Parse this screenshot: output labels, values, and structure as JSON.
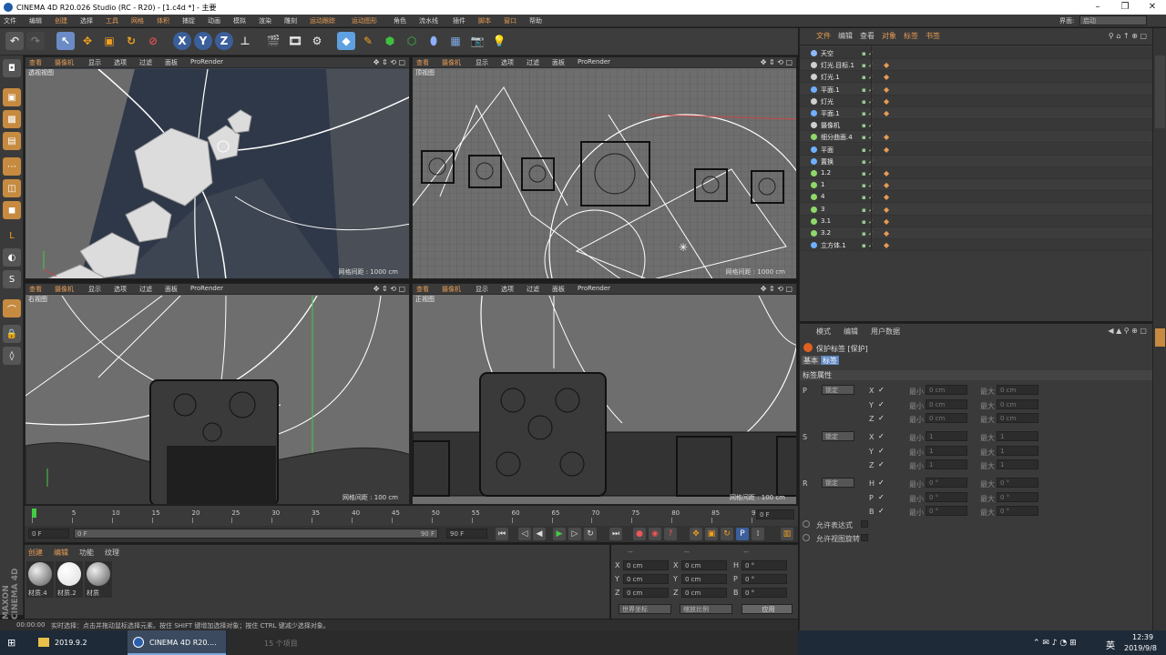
{
  "window": {
    "title": "CINEMA 4D R20.026 Studio (RC - R20) - [1.c4d *] - 主要"
  },
  "menu": [
    "文件",
    "编辑",
    "创建",
    "选择",
    "工具",
    "网格",
    "体积",
    "捕捉",
    "动画",
    "模拟",
    "渲染",
    "雕刻",
    "运动跟踪",
    "运动图形",
    "角色",
    "流水线",
    "插件",
    "脚本",
    "窗口",
    "帮助"
  ],
  "menu_highlight": [
    "创建",
    "工具",
    "网格",
    "体积",
    "运动跟踪",
    "运动图形",
    "脚本",
    "窗口"
  ],
  "interface": {
    "label": "界面:",
    "value": "启动"
  },
  "viewport_menu": [
    "查看",
    "摄像机",
    "显示",
    "选项",
    "过滤",
    "面板",
    "ProRender"
  ],
  "viewports": [
    {
      "label": "透视视图",
      "grid": ""
    },
    {
      "label": "顶视图",
      "grid": "网格间距 : 1000 cm"
    },
    {
      "label": "右视图",
      "grid": "网格间距 : 100 cm"
    },
    {
      "label": "正视图",
      "grid": "网格间距 : 100 cm"
    }
  ],
  "viewport1_grid": "网格间距 : 1000 cm",
  "timeline": {
    "ticks": [
      "0",
      "5",
      "10",
      "15",
      "20",
      "25",
      "30",
      "35",
      "40",
      "45",
      "50",
      "55",
      "60",
      "65",
      "70",
      "75",
      "80",
      "85",
      "90"
    ],
    "current": "0 F",
    "start": "0 F",
    "range_start": "0 F",
    "range_end": "90 F",
    "end": "90 F",
    "end2": "90 F"
  },
  "material_menu": [
    "创建",
    "编辑",
    "功能",
    "纹理"
  ],
  "materials": [
    "材质.4",
    "材质.2",
    "材质"
  ],
  "coords": {
    "headers": [
      "--",
      "--",
      "--"
    ],
    "rows": [
      [
        "X",
        "0 cm",
        "X",
        "0 cm",
        "H",
        "0 °"
      ],
      [
        "Y",
        "0 cm",
        "Y",
        "0 cm",
        "P",
        "0 °"
      ],
      [
        "Z",
        "0 cm",
        "Z",
        "0 cm",
        "B",
        "0 °"
      ]
    ],
    "mode1": "世界坐标",
    "mode2": "缩放比例",
    "apply": "应用"
  },
  "status": {
    "time": "00:00:00",
    "text": "实时选择：点击并拖动鼠标选择元素。按住 SHIFT 键增加选择对象；按住 CTRL 键减少选择对象。"
  },
  "objects_menu": [
    "文件",
    "编辑",
    "查看",
    "对象",
    "标签",
    "书签"
  ],
  "objects": [
    {
      "name": "天空",
      "color": "#8fb8ff"
    },
    {
      "name": "灯光.目标.1",
      "color": "#cfcfcf"
    },
    {
      "name": "灯光.1",
      "color": "#cfcfcf"
    },
    {
      "name": "平面.1",
      "color": "#6fb0ff"
    },
    {
      "name": "灯光",
      "color": "#cfcfcf"
    },
    {
      "name": "平面.1",
      "color": "#6fb0ff"
    },
    {
      "name": "摄像机",
      "color": "#cfcfcf"
    },
    {
      "name": "细分曲面.4",
      "color": "#8fd86a"
    },
    {
      "name": "平面",
      "color": "#6fb0ff"
    },
    {
      "name": "置换",
      "color": "#6fb0ff"
    },
    {
      "name": "1.2",
      "color": "#8fd86a"
    },
    {
      "name": "1",
      "color": "#8fd86a"
    },
    {
      "name": "4",
      "color": "#8fd86a"
    },
    {
      "name": "3",
      "color": "#8fd86a"
    },
    {
      "name": "3.1",
      "color": "#8fd86a"
    },
    {
      "name": "3.2",
      "color": "#8fd86a"
    },
    {
      "name": "立方体.1",
      "color": "#6fb0ff"
    }
  ],
  "attr": {
    "menu": [
      "模式",
      "编辑",
      "用户数据"
    ],
    "title": "保护标签 [保护]",
    "tabs": [
      "基本",
      "标签"
    ],
    "section": "标签属性",
    "groups": [
      {
        "k": "P",
        "v": "锁定",
        "axes": [
          "X",
          "Y",
          "Z"
        ],
        "val": "0 cm"
      },
      {
        "k": "S",
        "v": "锁定",
        "axes": [
          "X",
          "Y",
          "Z"
        ],
        "val": "1"
      },
      {
        "k": "R",
        "v": "锁定",
        "axes": [
          "H",
          "P",
          "B"
        ],
        "val": "0 °"
      }
    ],
    "min": "最小",
    "max": "最大",
    "opt1": "允许表达式",
    "opt2": "允许视图旋转"
  },
  "taskbar": {
    "item1": "2019.9.2",
    "item2": "CINEMA 4D R20....",
    "item3": "15 个项目",
    "time": "12:39",
    "date": "2019/9/8",
    "lang": "英"
  },
  "colors": {
    "accent": "#e79c55",
    "viewport_bg": "#6e6e6e",
    "panel": "#3a3a3a"
  }
}
